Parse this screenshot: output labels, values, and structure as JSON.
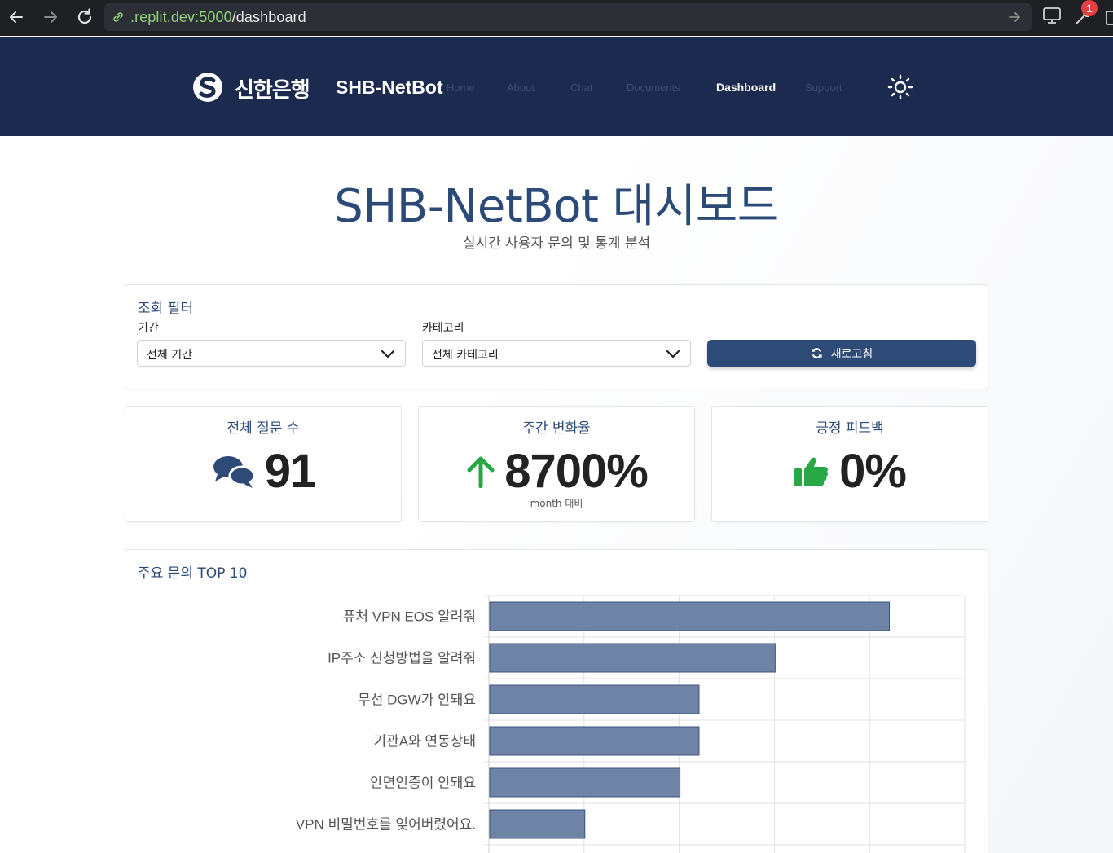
{
  "browser": {
    "url_host": ".replit.dev:5000",
    "url_path": "/dashboard",
    "notification_count": "1"
  },
  "header": {
    "bank_name": "신한은행",
    "brand": "SHB-NetBot",
    "nav": [
      "Home",
      "About",
      "Chat",
      "Documents",
      "Dashboard",
      "Support"
    ],
    "active_nav": "Dashboard"
  },
  "page": {
    "title": "SHB-NetBot 대시보드",
    "subtitle": "실시간 사용자 문의 및 통계 분석"
  },
  "filter": {
    "heading": "조회 필터",
    "period_label": "기간",
    "period_value": "전체 기간",
    "category_label": "카테고리",
    "category_value": "전체 카테고리",
    "refresh_label": "새로고침"
  },
  "stats": [
    {
      "label": "전체 질문 수",
      "value": "91",
      "icon": "comments-icon",
      "note": ""
    },
    {
      "label": "주간 변화율",
      "value": "8700%",
      "icon": "arrow-up-icon",
      "note": "month 대비"
    },
    {
      "label": "긍정 피드백",
      "value": "0%",
      "icon": "thumbs-up-icon",
      "note": ""
    }
  ],
  "colors": {
    "header_bg": "#1b2a4e",
    "title": "#2b4a78",
    "bar_fill": "#6e83a6",
    "bar_stroke": "#3c5582",
    "arrow_green": "#28a745",
    "thumb_green": "#28a745",
    "comments_blue": "#2e4b78"
  },
  "chart_data": {
    "type": "bar",
    "orientation": "horizontal",
    "title": "주요 문의 TOP 10",
    "categories": [
      "퓨처 VPN EOS 알려줘",
      "IP주소 신청방법을 알려줘",
      "무선 DGW가 안돼요",
      "기관A와 연동상태",
      "안면인증이 안돼요",
      "VPN 비밀번호를 잊어버렸어요."
    ],
    "values": [
      21,
      15,
      11,
      11,
      10,
      5
    ],
    "xlim": [
      0,
      25
    ],
    "grid": true
  }
}
